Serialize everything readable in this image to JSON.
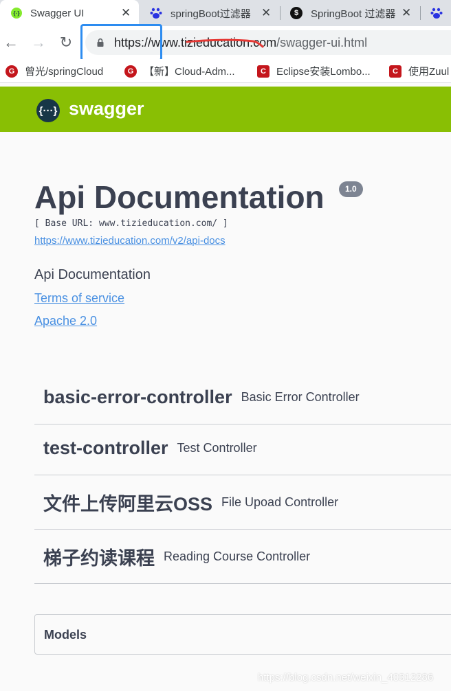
{
  "browser": {
    "tabs": [
      {
        "label": "Swagger UI",
        "icon": "swagger-icon",
        "active": true
      },
      {
        "label": "springBoot过滤器",
        "icon": "baidu-icon"
      },
      {
        "label": "SpringBoot 过滤器",
        "icon": "money-bag-icon"
      },
      {
        "label": "",
        "icon": "baidu-icon"
      }
    ],
    "url": {
      "host": "https://www.tizieducation.com",
      "path": "/swagger-ui.html"
    },
    "bookmarks": [
      {
        "label": "曾光/springCloud",
        "icon": "gitee-icon"
      },
      {
        "label": "【新】Cloud-Adm...",
        "icon": "gitee-icon"
      },
      {
        "label": "Eclipse安装Lombo...",
        "icon": "csdn-icon"
      },
      {
        "label": "使用Zuul",
        "icon": "csdn-icon"
      }
    ]
  },
  "swagger": {
    "logo_text": "swagger",
    "logo_glyph": "{···}",
    "title": "Api Documentation",
    "version": "1.0",
    "base_url": "[ Base URL: www.tizieducation.com/ ]",
    "api_docs_url": "https://www.tizieducation.com/v2/api-docs",
    "description": "Api Documentation",
    "terms_link": "Terms of service",
    "license_link": "Apache 2.0",
    "tags": [
      {
        "name": "basic-error-controller",
        "description": "Basic Error Controller"
      },
      {
        "name": "test-controller",
        "description": "Test Controller"
      },
      {
        "name": "文件上传阿里云OSS",
        "description": "File Upoad Controller"
      },
      {
        "name": "梯子约读课程",
        "description": "Reading Course Controller"
      }
    ],
    "models_title": "Models"
  },
  "watermark": "https://blog.csdn.net/weixin_40312286",
  "colors": {
    "accent": "#89bf04",
    "link": "#4990e2",
    "text": "#3b4151",
    "annotation_box": "#2d8cf0",
    "annotation_line": "#e53935"
  }
}
